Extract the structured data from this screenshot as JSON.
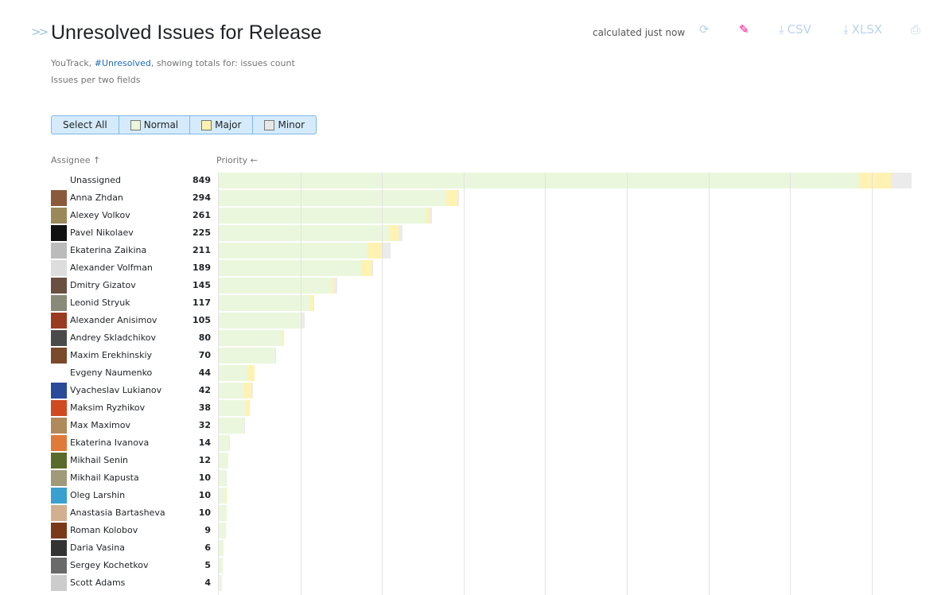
{
  "header": {
    "title": "Unresolved Issues for Release",
    "source_prefix": "YouTrack, ",
    "source_query": "#Unresolved",
    "source_suffix": ", showing totals for: issues count",
    "description": "Issues per two fields",
    "calculated": "calculated just now",
    "csv_label": "CSV",
    "xlsx_label": "XLSX"
  },
  "filters": {
    "select_all": "Select All",
    "items": [
      {
        "label": "Normal",
        "color": "#e9f6db"
      },
      {
        "label": "Major",
        "color": "#fff1ae"
      },
      {
        "label": "Minor",
        "color": "#e8e8e8"
      }
    ]
  },
  "columns": {
    "assignee": "Assignee ↑",
    "priority": "Priority ←"
  },
  "colors": {
    "normal": "#eaf7dc",
    "major": "#fff2b2",
    "minor": "#ebebeb",
    "accent": "#ff008c"
  },
  "chart_data": {
    "type": "bar",
    "stacked": true,
    "orientation": "horizontal",
    "series_names": [
      "Normal",
      "Major",
      "Minor"
    ],
    "xlim": [
      0,
      850
    ],
    "grid_step": 100,
    "rows": [
      {
        "name": "Unassigned",
        "total": 849,
        "values": [
          786,
          38,
          25
        ],
        "avatar": ""
      },
      {
        "name": "Anna Zhdan",
        "total": 294,
        "values": [
          279,
          13,
          2
        ],
        "avatar": "#8a5a3a"
      },
      {
        "name": "Alexey Volkov",
        "total": 261,
        "values": [
          254,
          4,
          3
        ],
        "avatar": "#9a8a5a"
      },
      {
        "name": "Pavel Nikolaev",
        "total": 225,
        "values": [
          209,
          11,
          5
        ],
        "avatar": "#111111"
      },
      {
        "name": "Ekaterina Zaikina",
        "total": 211,
        "values": [
          182,
          19,
          10
        ],
        "avatar": "#bbbbbb"
      },
      {
        "name": "Alexander Volfman",
        "total": 189,
        "values": [
          174,
          13,
          2
        ],
        "avatar": "#dddddd"
      },
      {
        "name": "Dmitry Gizatov",
        "total": 145,
        "values": [
          137,
          4,
          4
        ],
        "avatar": "#6a5040"
      },
      {
        "name": "Leonid Stryuk",
        "total": 117,
        "values": [
          112,
          4,
          1
        ],
        "avatar": "#8a8a7a"
      },
      {
        "name": "Alexander Anisimov",
        "total": 105,
        "values": [
          100,
          1,
          4
        ],
        "avatar": "#9a3a20"
      },
      {
        "name": "Andrey Skladchikov",
        "total": 80,
        "values": [
          78,
          2,
          0
        ],
        "avatar": "#4a4a4a"
      },
      {
        "name": "Maxim Erekhinskiy",
        "total": 70,
        "values": [
          68,
          0,
          2
        ],
        "avatar": "#7a4a2a"
      },
      {
        "name": "Evgeny Naumenko",
        "total": 44,
        "values": [
          35,
          9,
          0
        ],
        "avatar": "#ffffff"
      },
      {
        "name": "Vyacheslav Lukianov",
        "total": 42,
        "values": [
          31,
          9,
          2
        ],
        "avatar": "#2a4a9a"
      },
      {
        "name": "Maksim Ryzhikov",
        "total": 38,
        "values": [
          33,
          4,
          1
        ],
        "avatar": "#d04a20"
      },
      {
        "name": "Max Maximov",
        "total": 32,
        "values": [
          31,
          0,
          1
        ],
        "avatar": "#b08a5a"
      },
      {
        "name": "Ekaterina Ivanova",
        "total": 14,
        "values": [
          13,
          0,
          1
        ],
        "avatar": "#e07a3a"
      },
      {
        "name": "Mikhail Senin",
        "total": 12,
        "values": [
          12,
          0,
          0
        ],
        "avatar": "#5a6a2a"
      },
      {
        "name": "Mikhail Kapusta",
        "total": 10,
        "values": [
          9,
          0,
          1
        ],
        "avatar": "#a09a7a"
      },
      {
        "name": "Oleg Larshin",
        "total": 10,
        "values": [
          9,
          1,
          0
        ],
        "avatar": "#3aa0d0"
      },
      {
        "name": "Anastasia Bartasheva",
        "total": 10,
        "values": [
          10,
          0,
          0
        ],
        "avatar": "#d0b090"
      },
      {
        "name": "Roman Kolobov",
        "total": 9,
        "values": [
          8,
          1,
          0
        ],
        "avatar": "#7a3a1a"
      },
      {
        "name": "Daria Vasina",
        "total": 6,
        "values": [
          6,
          0,
          0
        ],
        "avatar": "#333333"
      },
      {
        "name": "Sergey Kochetkov",
        "total": 5,
        "values": [
          5,
          0,
          0
        ],
        "avatar": "#6a6a6a"
      },
      {
        "name": "Scott Adams",
        "total": 4,
        "values": [
          4,
          0,
          0
        ],
        "avatar": "#cccccc"
      }
    ]
  }
}
